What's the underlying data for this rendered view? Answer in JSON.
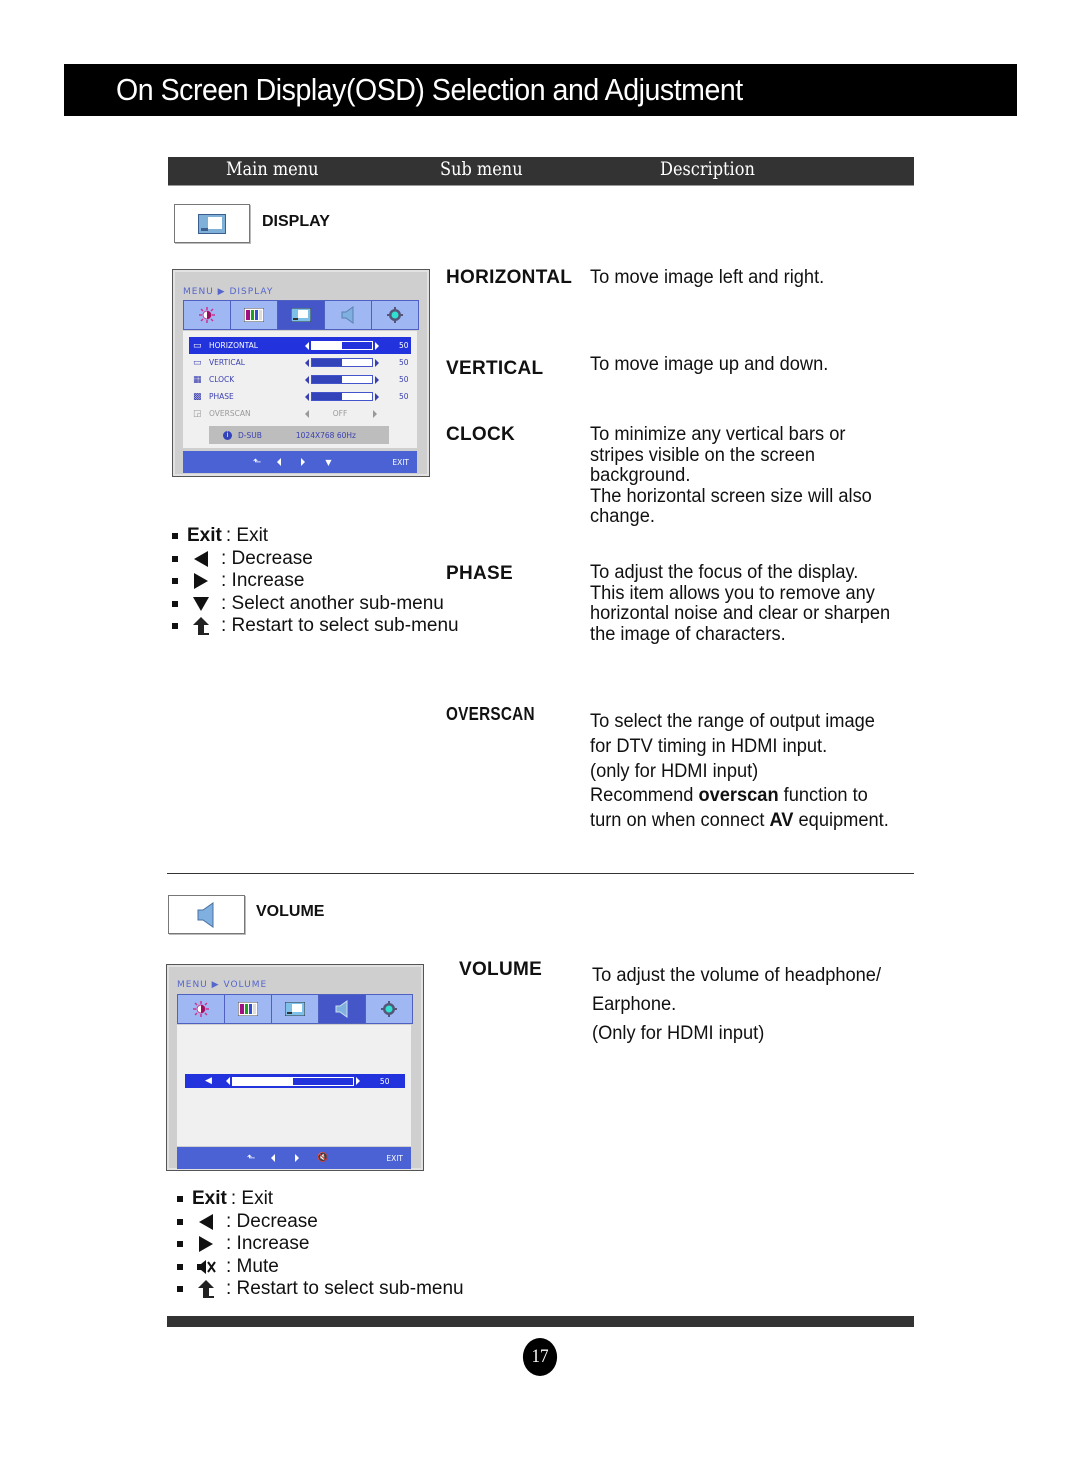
{
  "page": {
    "title": "On Screen Display(OSD) Selection and Adjustment",
    "page_number": "17"
  },
  "table_header": {
    "main_menu": "Main menu",
    "sub_menu": "Sub menu",
    "description": "Description"
  },
  "display_section": {
    "label": "DISPLAY",
    "icon": "display-icon",
    "osd": {
      "breadcrumb_menu": "MENU",
      "breadcrumb_item": "DISPLAY",
      "tabs": [
        {
          "icon": "brightness-icon",
          "active": false
        },
        {
          "icon": "color-bars-icon",
          "active": false
        },
        {
          "icon": "display-icon",
          "active": true
        },
        {
          "icon": "volume-icon",
          "active": false
        },
        {
          "icon": "settings-gear-icon",
          "active": false
        }
      ],
      "rows": [
        {
          "label": "HORIZONTAL",
          "icon": "horizontal-icon",
          "value": "50",
          "level": 0.5,
          "selected": true
        },
        {
          "label": "VERTICAL",
          "icon": "vertical-icon",
          "value": "50",
          "level": 0.5,
          "selected": false
        },
        {
          "label": "CLOCK",
          "icon": "clock-icon",
          "value": "50",
          "level": 0.5,
          "selected": false
        },
        {
          "label": "PHASE",
          "icon": "phase-icon",
          "value": "50",
          "level": 0.5,
          "selected": false
        },
        {
          "label": "OVERSCAN",
          "icon": "overscan-icon",
          "value": "OFF",
          "selected": false,
          "disabled": true
        }
      ],
      "info": {
        "source": "D-SUB",
        "resolution": "1024X768  60Hz"
      },
      "footer_exit": "EXIT"
    },
    "legend": [
      {
        "key": "Exit",
        "text": ": Exit"
      },
      {
        "icon": "left-triangle-icon",
        "text": ": Decrease"
      },
      {
        "icon": "right-triangle-icon",
        "text": ": Increase"
      },
      {
        "icon": "down-triangle-icon",
        "text": ": Select another sub-menu"
      },
      {
        "icon": "return-arrow-icon",
        "text": ": Restart to select sub-menu"
      }
    ],
    "submenus": [
      {
        "name": "HORIZONTAL",
        "description": [
          "To move image left and right."
        ]
      },
      {
        "name": "VERTICAL",
        "description": [
          "To move image up and down."
        ]
      },
      {
        "name": "CLOCK",
        "description": [
          "To minimize any vertical bars or",
          "stripes visible on the screen",
          "background.",
          "The horizontal screen size will also",
          "change."
        ]
      },
      {
        "name": "PHASE",
        "description": [
          "To adjust the focus of the display.",
          "This item allows you to remove any",
          "horizontal noise and clear or sharpen",
          "the image of characters."
        ]
      },
      {
        "name": "OVERSCAN",
        "description_lines": {
          "l1": "To select the range of output image",
          "l2": "for DTV timing in HDMI input.",
          "l3": "(only for HDMI input)",
          "l4_pre": "Recommend ",
          "l4_bold": "overscan",
          "l4_post": " function to",
          "l5_pre": "turn on when connect ",
          "l5_bold": "AV",
          "l5_post": " equipment."
        }
      }
    ]
  },
  "volume_section": {
    "label": "VOLUME",
    "icon": "volume-icon",
    "osd": {
      "breadcrumb_menu": "MENU",
      "breadcrumb_item": "VOLUME",
      "slider_value": "50",
      "slider_level": 0.5,
      "footer_exit": "EXIT"
    },
    "legend": [
      {
        "key": "Exit",
        "text": ": Exit"
      },
      {
        "icon": "left-triangle-icon",
        "text": ": Decrease"
      },
      {
        "icon": "right-triangle-icon",
        "text": ": Increase"
      },
      {
        "icon": "mute-icon",
        "text": ": Mute"
      },
      {
        "icon": "return-arrow-icon",
        "text": ": Restart to select sub-menu"
      }
    ],
    "submenu": {
      "name": "VOLUME",
      "description": [
        "To adjust the volume of headphone/",
        "Earphone.",
        "(Only for HDMI input)"
      ]
    }
  }
}
